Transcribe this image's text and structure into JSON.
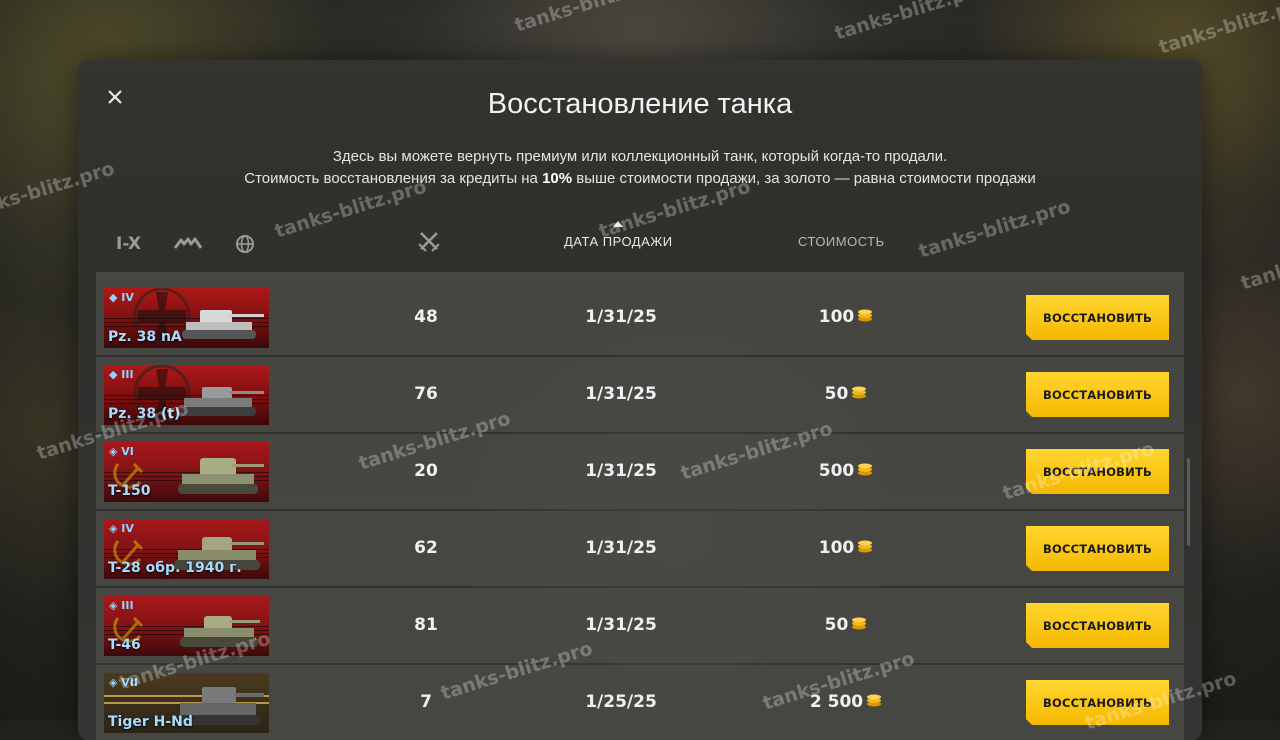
{
  "dialog": {
    "title": "Восстановление танка",
    "subtitle_line1": "Здесь вы можете вернуть премиум или коллекционный танк, который когда-то продали.",
    "subtitle_line2_pre": "Стоимость восстановления за кредиты на ",
    "subtitle_line2_bold": "10%",
    "subtitle_line2_post": " выше стоимости продажи, за золото — равна стоимости продажи",
    "close_icon": "close-icon"
  },
  "filters": {
    "tier_label": "I-X",
    "type_icon": "tank-type-icon",
    "nation_icon": "globe-icon"
  },
  "columns": {
    "battles_icon": "crossed-swords-icon",
    "date": "ДАТА ПРОДАЖИ",
    "cost": "СТОИМОСТЬ",
    "sort": "descending"
  },
  "restore_label": "ВОССТАНОВИТЬ",
  "rows": [
    {
      "tier": "IV",
      "name": "Pz. 38 nA",
      "nation": "germany",
      "battles": "48",
      "date": "1/31/25",
      "cost": "100"
    },
    {
      "tier": "III",
      "name": "Pz. 38 (t)",
      "nation": "germany",
      "battles": "76",
      "date": "1/31/25",
      "cost": "50"
    },
    {
      "tier": "VI",
      "name": "T-150",
      "nation": "ussr",
      "battles": "20",
      "date": "1/31/25",
      "cost": "500"
    },
    {
      "tier": "IV",
      "name": "T-28 обр. 1940 г.",
      "nation": "ussr",
      "battles": "62",
      "date": "1/31/25",
      "cost": "100"
    },
    {
      "tier": "III",
      "name": "T-46",
      "nation": "ussr",
      "battles": "81",
      "date": "1/31/25",
      "cost": "50"
    },
    {
      "tier": "VII",
      "name": "Tiger H-Nd",
      "nation": "germany-premium",
      "battles": "7",
      "date": "1/25/25",
      "cost": "2 500"
    }
  ],
  "watermark": "tanks-blitz.pro",
  "colors": {
    "button_yellow": "#f5c000",
    "tank_name": "#a8dcff",
    "card_red": "#8e1212"
  }
}
